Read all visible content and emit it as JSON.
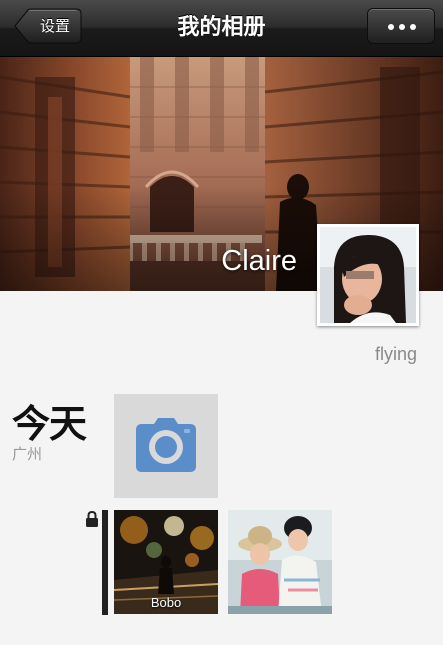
{
  "navbar": {
    "title": "我的相册",
    "back_label": "设置",
    "more_icon": "more-dots-icon"
  },
  "profile": {
    "name": "Claire",
    "signature": "flying"
  },
  "timeline": {
    "day": "今天",
    "location": "广州",
    "camera_icon": "camera-icon",
    "lock_icon": "lock-icon",
    "photos": [
      {
        "caption": "Bobo"
      },
      {
        "caption": ""
      }
    ]
  },
  "colors": {
    "navbar_top": "#4a4a4a",
    "navbar_bottom": "#151515",
    "background": "#f4f4f4",
    "camera_blue": "#5b8dc9",
    "camera_tile": "#d9d9d9"
  }
}
